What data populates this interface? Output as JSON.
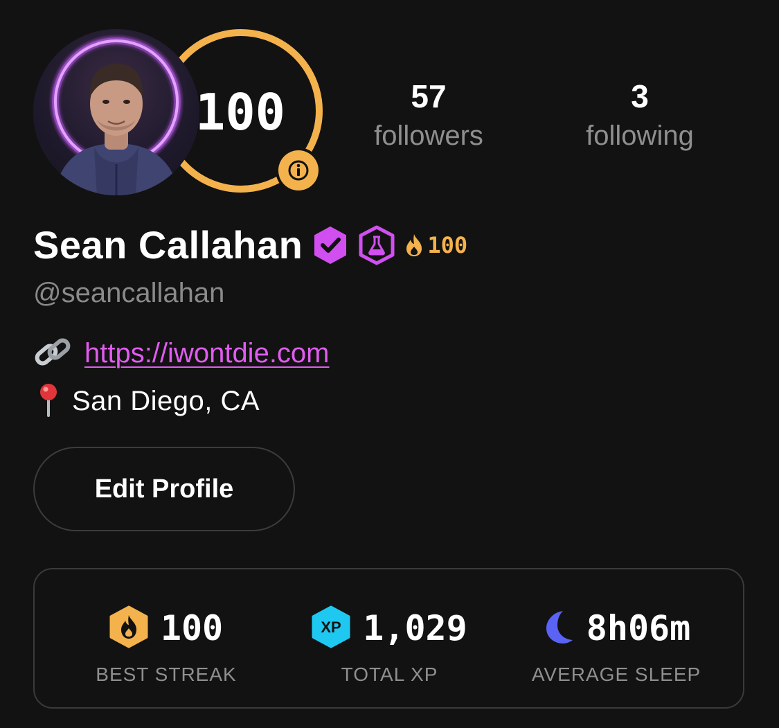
{
  "profile": {
    "score": "100",
    "followers_count": "57",
    "followers_label": "followers",
    "following_count": "3",
    "following_label": "following",
    "name": "Sean Callahan",
    "streak": "100",
    "handle": "@seancallahan",
    "website": "https://iwontdie.com",
    "location": "San Diego, CA",
    "edit_button": "Edit Profile"
  },
  "stats": {
    "best_streak": {
      "value": "100",
      "label": "BEST STREAK",
      "icon": "flame-hexagon-icon"
    },
    "total_xp": {
      "value": "1,029",
      "label": "TOTAL XP",
      "icon_text": "XP",
      "icon": "xp-hexagon-icon"
    },
    "average_sleep": {
      "value": "8h06m",
      "label": "AVERAGE SLEEP",
      "icon": "moon-icon"
    }
  },
  "colors": {
    "background": "#121212",
    "ring": "#f4b24c",
    "accent_purple": "#d14ff0",
    "link": "#e05cf0",
    "xp_cyan": "#1ec8f0",
    "moon": "#5b63f5"
  }
}
